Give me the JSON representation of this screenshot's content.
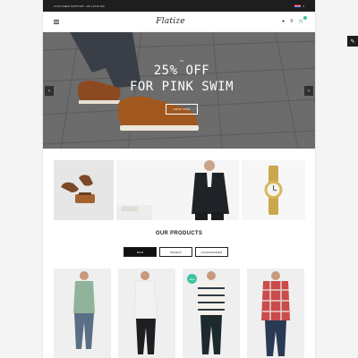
{
  "topbar": {
    "support_text": "CUSTOMER SUPPORT: +86 12345 456",
    "language": "EN"
  },
  "header": {
    "logo": "Flatize"
  },
  "hero": {
    "small_label": "SS",
    "line1": "25% OFF",
    "line2": "FOR PINK SWIM",
    "cta": "SHOP NOW"
  },
  "section": {
    "title": "OUR PRODUCTS"
  },
  "tabs": [
    "MAN",
    "WOMAN",
    "ACCESSORIES"
  ],
  "products": [
    {
      "badge": ""
    },
    {
      "badge": ""
    },
    {
      "badge": "New"
    },
    {
      "badge": ""
    }
  ],
  "colors": {
    "accent": "#3ec3a4",
    "dark": "#1e1e1e"
  }
}
